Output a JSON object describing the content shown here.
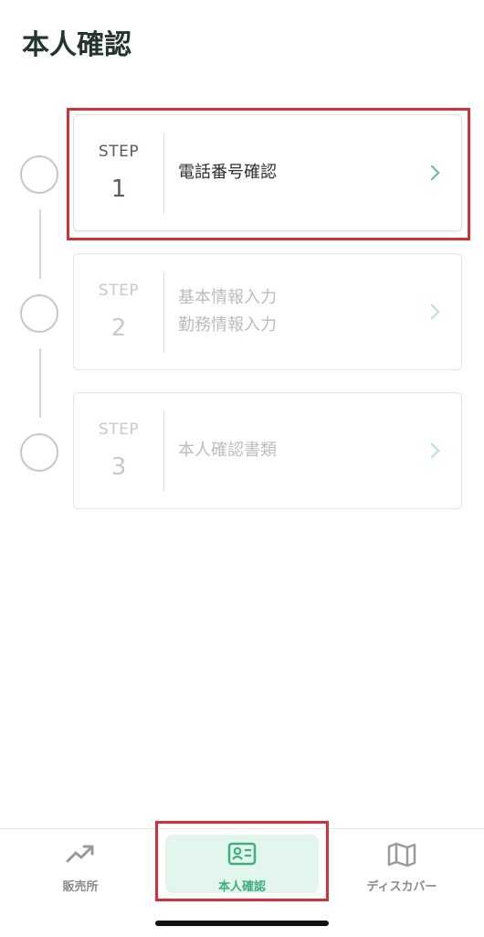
{
  "header": {
    "title": "本人確認"
  },
  "steps": [
    {
      "label": "STEP",
      "number": "1",
      "lines": [
        "電話番号確認"
      ],
      "state": "active"
    },
    {
      "label": "STEP",
      "number": "2",
      "lines": [
        "基本情報入力",
        "勤務情報入力"
      ],
      "state": "inactive"
    },
    {
      "label": "STEP",
      "number": "3",
      "lines": [
        "本人確認書類"
      ],
      "state": "inactive"
    }
  ],
  "tabbar": {
    "items": [
      {
        "label": "販売所",
        "icon": "trend-up-icon",
        "selected": false
      },
      {
        "label": "本人確認",
        "icon": "id-card-icon",
        "selected": true
      },
      {
        "label": "ディスカバー",
        "icon": "map-icon",
        "selected": false
      }
    ]
  },
  "colors": {
    "accent": "#5bbf95",
    "selected_tab_bg": "#e3f6ee",
    "highlight_border": "#d0313b",
    "title": "#24352e"
  }
}
